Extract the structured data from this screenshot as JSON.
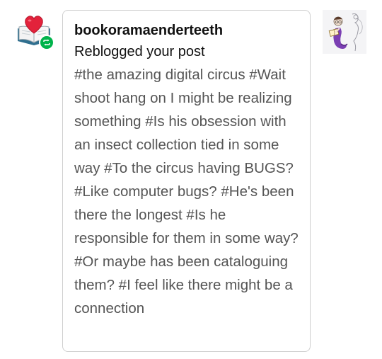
{
  "notification": {
    "avatar_icon": "book-heart-icon",
    "badge_icon": "reblog-icon",
    "badge_color": "#00b34b",
    "username": "bookoramaenderteeth",
    "action": "Reblogged your post",
    "tags": "#the amazing digital circus #Wait shoot hang on I might be realizing something #Is his obsession with an insect collection tied in some way #To the circus having BUGS? #Like computer bugs? #He's been there the longest #Is he responsible for them in some way? #Or maybe has been cataloguing them? #I feel like there might be a connection",
    "post_thumbnail": "post-thumbnail-illustration"
  }
}
